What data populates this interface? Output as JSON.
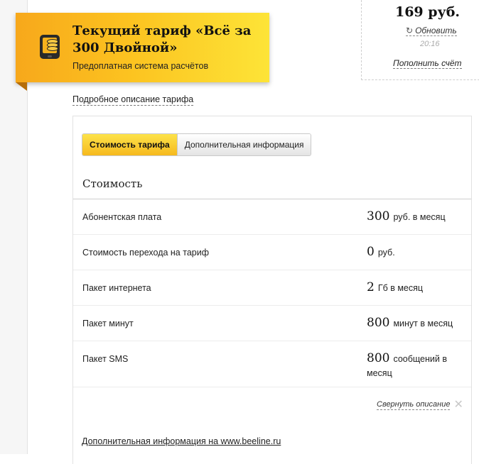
{
  "balance": {
    "amount": "169 руб.",
    "refresh_label": "Обновить",
    "time": "20:16",
    "topup_label": "Пополнить счёт"
  },
  "tariff": {
    "title": "Текущий тариф «Всё за 300 Двойной»",
    "subtitle": "Предоплатная система расчётов"
  },
  "detail_link": "Подробное описание тарифа",
  "tabs": [
    {
      "label": "Стоимость тарифа",
      "active": true
    },
    {
      "label": "Дополнительная информация",
      "active": false
    }
  ],
  "section_title": "Стоимость",
  "rows": [
    {
      "label": "Абонентская плата",
      "value": "300",
      "unit": "руб. в месяц"
    },
    {
      "label": "Стоимость перехода на тариф",
      "value": "0",
      "unit": "руб."
    },
    {
      "label": "Пакет интернета",
      "value": "2",
      "unit": "Гб в месяц"
    },
    {
      "label": "Пакет минут",
      "value": "800",
      "unit": "минут в месяц"
    },
    {
      "label": "Пакет SMS",
      "value": "800",
      "unit": "сообщений в месяц"
    }
  ],
  "collapse_label": "Свернуть описание",
  "more_info": "Дополнительная информация на www.beeline.ru",
  "colors": {
    "accent": "#fcc320",
    "accent_dark": "#f7a81b"
  }
}
